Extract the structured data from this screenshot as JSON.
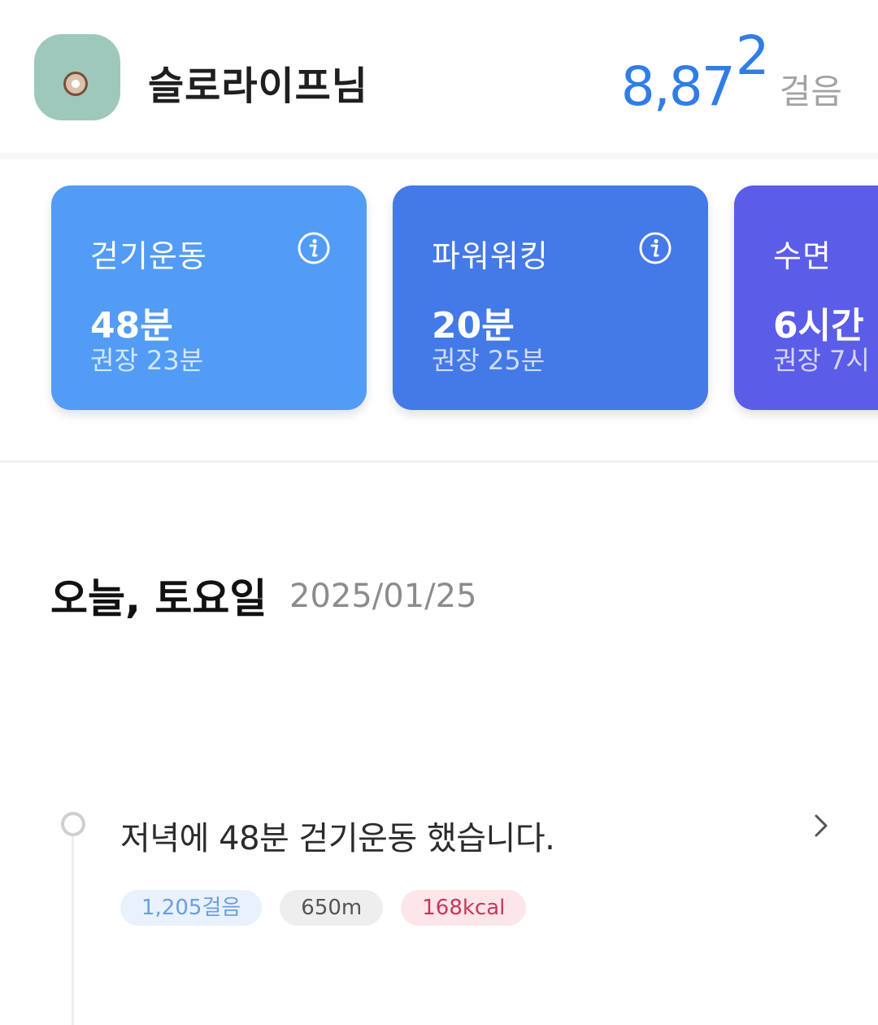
{
  "header": {
    "username": "슬로라이프님",
    "steps_main": "8,87",
    "steps_last": "2",
    "steps_unit": "걸음"
  },
  "cards": [
    {
      "title": "걷기운동",
      "value": "48분",
      "recommended": "권장 23분",
      "color": "#529cf5",
      "icon": "info-icon"
    },
    {
      "title": "파워워킹",
      "value": "20분",
      "recommended": "권장 25분",
      "color": "#4479e8",
      "icon": "info-icon"
    },
    {
      "title": "수면",
      "value": "6시간",
      "recommended": "권장 7시",
      "color": "#5b5de8",
      "icon": "info-icon"
    }
  ],
  "today": {
    "title": "오늘, 토요일",
    "date": "2025/01/25"
  },
  "timeline": {
    "entry_text": "저녁에 48분 걷기운동 했습니다.",
    "chips": [
      {
        "label": "1,205걸음",
        "bg": "#e8f1fc",
        "fg": "#6b9ede"
      },
      {
        "label": "650m",
        "bg": "#eeeeee",
        "fg": "#555555"
      },
      {
        "label": "168kcal",
        "bg": "#fce6ea",
        "fg": "#c8385a"
      }
    ]
  }
}
